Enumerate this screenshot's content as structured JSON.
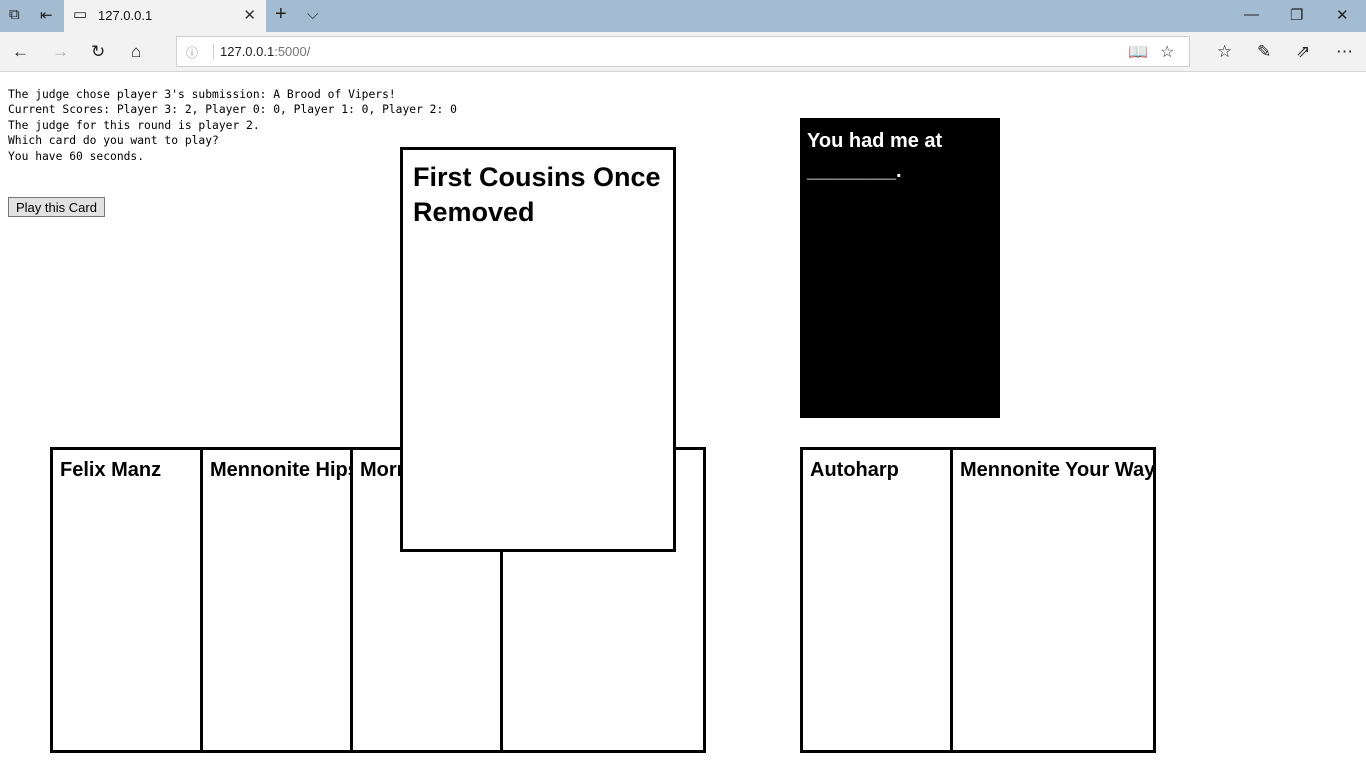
{
  "browser": {
    "tab_title": "127.0.0.1",
    "url_host": "127.0.0.1",
    "url_rest": ":5000/"
  },
  "status": {
    "line1": "The judge chose player 3's submission: A Brood of Vipers!",
    "line2": "Current Scores: Player 3: 2, Player 0: 0, Player 1: 0, Player 2: 0",
    "line3": "The judge for this round is player 2.",
    "line4": "Which card do you want to play?",
    "line5": "You have 60 seconds."
  },
  "play_button": "Play this Card",
  "selected_card": "First Cousins Once Removed",
  "black_card": "You had me at ________.",
  "hand": [
    "Felix Manz",
    "Mennonite Hips",
    "Morr",
    ""
  ],
  "submitted": [
    "Autoharp",
    "Mennonite Your Way"
  ]
}
